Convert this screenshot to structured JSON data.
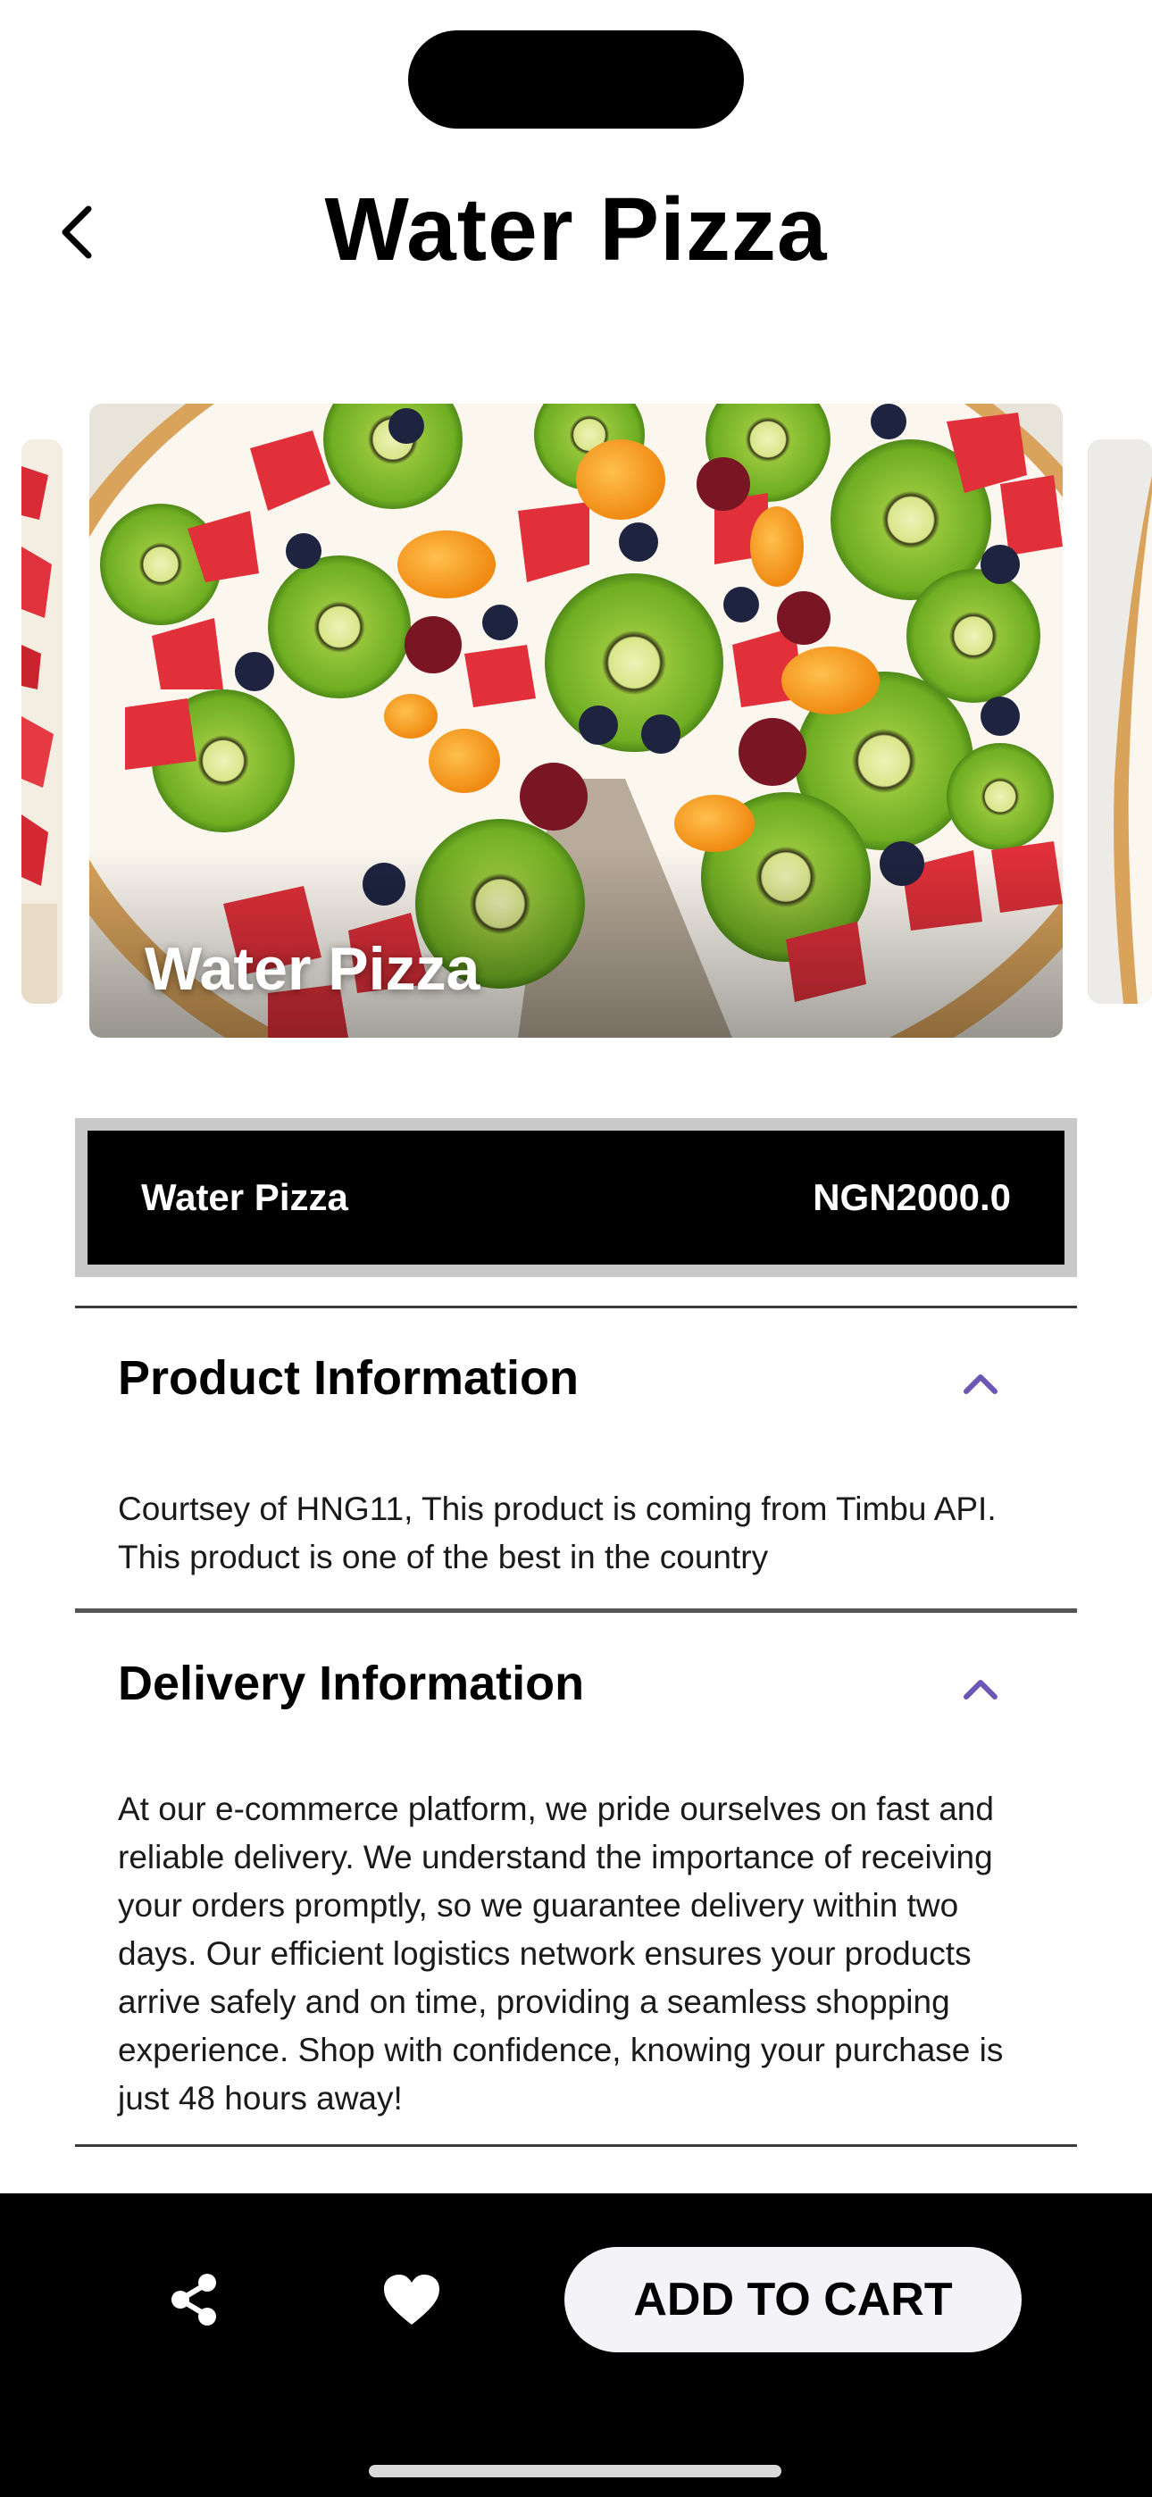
{
  "header": {
    "title": "Water Pizza",
    "back_icon": "chevron-left-icon"
  },
  "carousel": {
    "caption": "Water Pizza"
  },
  "product": {
    "name": "Water Pizza",
    "price": "NGN2000.0"
  },
  "sections": [
    {
      "title": "Product Information",
      "body": "Courtsey of HNG11, This product is coming from Timbu API. This product is one of the best in the country",
      "expanded_icon": "chevron-up-icon"
    },
    {
      "title": "Delivery Information",
      "body": "At our e-commerce platform, we pride ourselves on fast and reliable delivery. We understand the importance of receiving your orders promptly, so we guarantee delivery within two days. Our efficient logistics network ensures your products arrive safely and on time, providing a seamless shopping experience. Shop with confidence, knowing your purchase is just 48 hours away!",
      "expanded_icon": "chevron-up-icon"
    }
  ],
  "bottom_bar": {
    "share_icon": "share-icon",
    "favorite_icon": "heart-icon",
    "add_to_cart_label": "ADD TO CART"
  },
  "colors": {
    "accent": "#6b55b5",
    "bar_background": "#000000",
    "button_background": "#f4f3f8"
  }
}
